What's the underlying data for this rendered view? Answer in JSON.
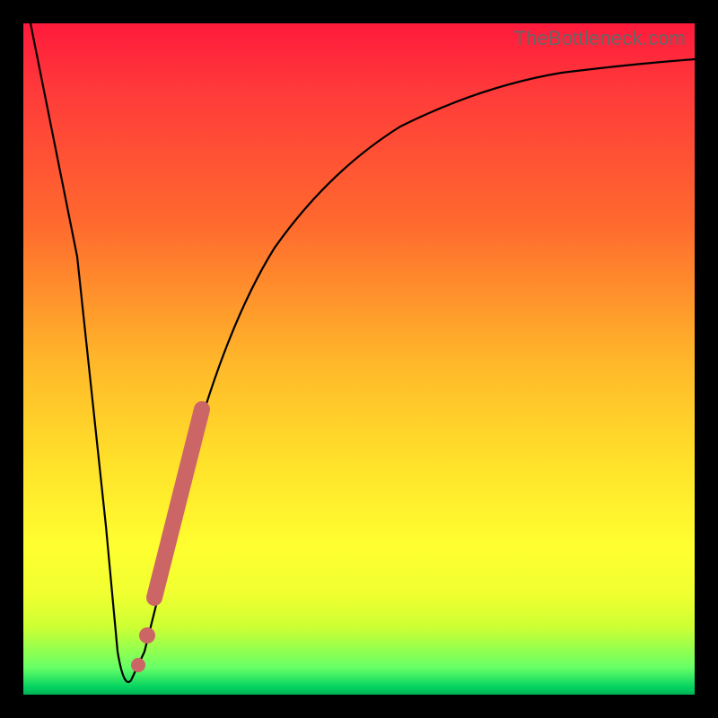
{
  "watermark": "TheBottleneck.com",
  "chart_data": {
    "type": "line",
    "title": "",
    "xlabel": "",
    "ylabel": "",
    "xlim": [
      0,
      100
    ],
    "ylim": [
      0,
      100
    ],
    "grid": false,
    "series": [
      {
        "name": "bottleneck-curve",
        "x": [
          0,
          5,
          10,
          12,
          14,
          16,
          18,
          20,
          25,
          30,
          35,
          40,
          50,
          60,
          70,
          80,
          90,
          100
        ],
        "values": [
          100,
          60,
          20,
          5,
          1,
          3,
          10,
          20,
          40,
          55,
          65,
          72,
          82,
          87,
          90,
          92,
          93,
          94
        ]
      }
    ],
    "overlays": [
      {
        "name": "highlight-segment",
        "type": "thick-line",
        "x": [
          18.5,
          24.5
        ],
        "values": [
          15,
          45
        ]
      },
      {
        "name": "highlight-dot-1",
        "type": "dot",
        "x": 17,
        "value": 7
      },
      {
        "name": "highlight-dot-2",
        "type": "dot",
        "x": 15.5,
        "value": 3
      }
    ]
  }
}
